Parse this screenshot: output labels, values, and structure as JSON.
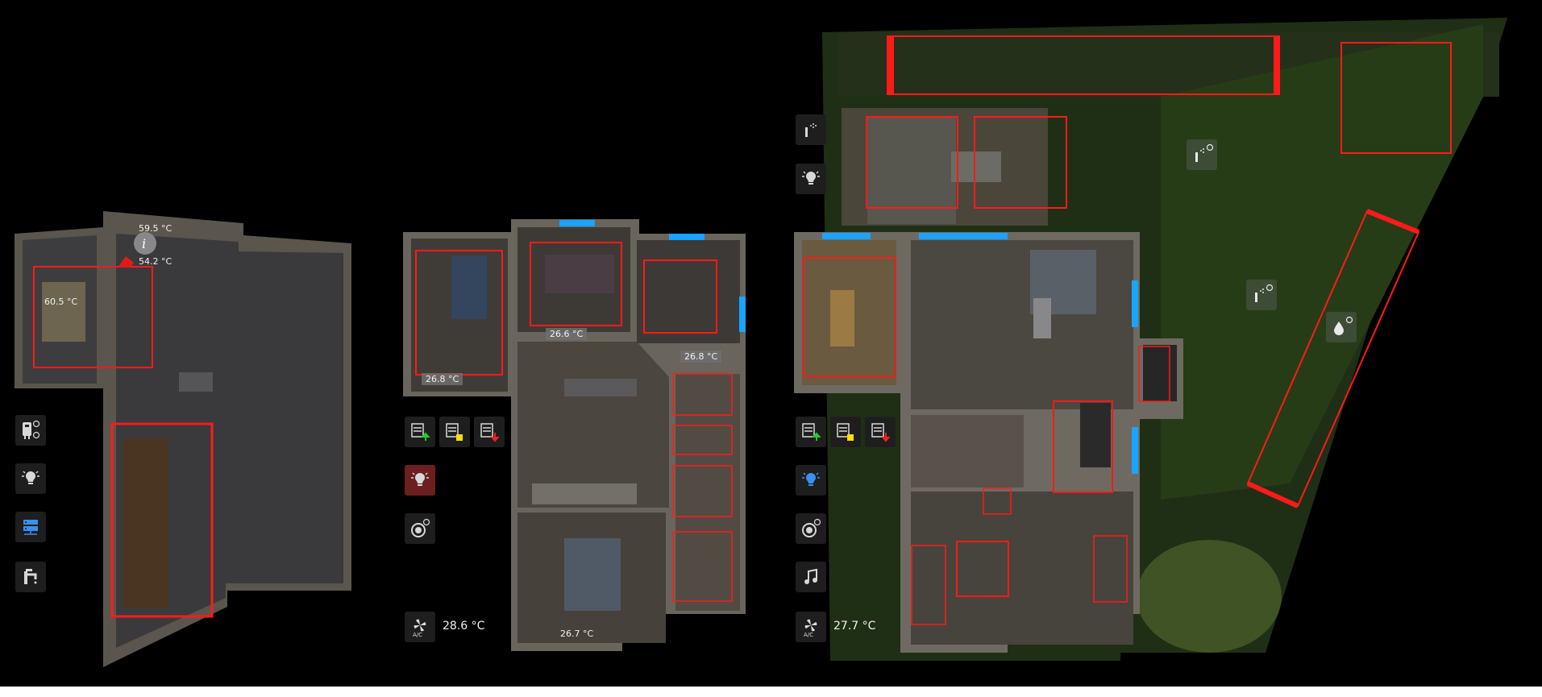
{
  "colors": {
    "zone_outline": "#ff1a1a",
    "window_marker": "#1aa3ff",
    "active_icon": "#3b8ff0",
    "icon": "#d8d8d8",
    "arrow_up": "#22cc22",
    "arrow_down": "#ee2222",
    "stop_square": "#ffdd00"
  },
  "basement": {
    "sensor_top": "59.5 °C",
    "sensor_bottom": "54.2 °C",
    "boiler_temp": "60.5 °C"
  },
  "upper_floor": {
    "room_temps": [
      "26.8 °C",
      "26.6 °C",
      "26.8 °C",
      "26.7 °C"
    ],
    "ac_temp": "28.6 °C"
  },
  "ground_floor": {
    "ac_temp": "27.7 °C"
  },
  "icons": {
    "basement": [
      "water-heater-timer-icon",
      "light-icon",
      "server-icon",
      "water-tap-icon"
    ],
    "upper": [
      "blinds-up-icon",
      "blinds-stop-icon",
      "blinds-down-icon",
      "light-icon",
      "robot-vacuum-timer-icon",
      "ac-icon"
    ],
    "ground": [
      "blinds-up-icon",
      "blinds-stop-icon",
      "blinds-down-icon",
      "light-icon",
      "robot-vacuum-timer-icon",
      "music-icon",
      "ac-icon"
    ],
    "garden": [
      "sprinkler-icon",
      "garden-light-icon",
      "sprinkler-timer-icon",
      "sprinkler-timer-icon",
      "drip-timer-icon"
    ]
  }
}
